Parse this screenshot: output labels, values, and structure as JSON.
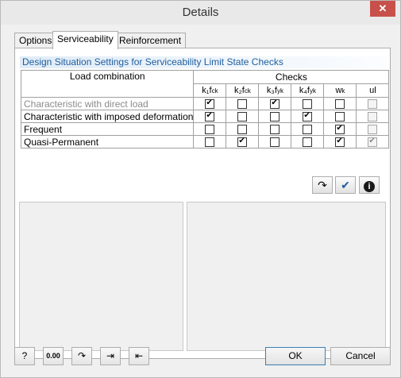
{
  "window": {
    "title": "Details"
  },
  "tabs": [
    {
      "label": "Options"
    },
    {
      "label": "Serviceability"
    },
    {
      "label": "Reinforcement"
    }
  ],
  "section": {
    "title": "Design Situation Settings for Serviceability Limit State Checks"
  },
  "table": {
    "load_header": "Load combination",
    "checks_header": "Checks",
    "columns": [
      {
        "main": "k₁f",
        "sub": "ck"
      },
      {
        "main": "k₂f",
        "sub": "ck"
      },
      {
        "main": "k₃f",
        "sub": "yk"
      },
      {
        "main": "k₄f",
        "sub": "yk"
      },
      {
        "main": "w",
        "sub": "k"
      },
      {
        "main": "ul",
        "sub": ""
      }
    ],
    "rows": [
      {
        "label": "Characteristic with direct load",
        "checks": [
          true,
          false,
          true,
          false,
          false,
          false
        ]
      },
      {
        "label": "Characteristic with imposed deformation",
        "checks": [
          true,
          false,
          false,
          true,
          false,
          false
        ]
      },
      {
        "label": "Frequent",
        "checks": [
          false,
          false,
          false,
          false,
          true,
          false
        ]
      },
      {
        "label": "Quasi-Permanent",
        "checks": [
          false,
          true,
          false,
          false,
          true,
          true
        ]
      }
    ]
  },
  "footer": {
    "ok_label": "OK",
    "cancel_label": "Cancel",
    "zero_label": "0.00"
  },
  "icons": {
    "reset": "reset-icon",
    "apply": "check-icon",
    "info": "info-icon",
    "help": "help-icon",
    "units": "units-icon"
  }
}
